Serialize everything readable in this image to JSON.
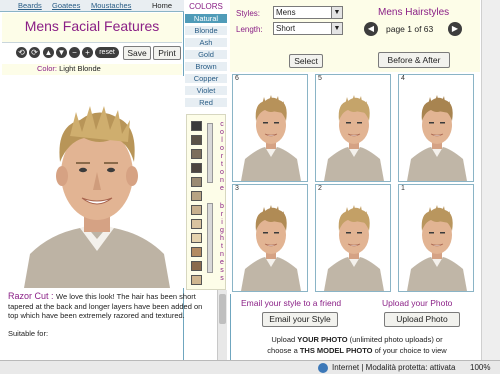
{
  "tabs": [
    "Beards",
    "Goatees",
    "Moustaches",
    "Home"
  ],
  "facial_title": "Mens Facial Features",
  "toolbar": {
    "tool_icons": [
      "rotate-left-icon",
      "rotate-right-icon",
      "arrow-up-icon",
      "arrow-down-icon",
      "minus-icon",
      "plus-icon"
    ],
    "reset_label": "reset",
    "save_label": "Save",
    "print_label": "Print"
  },
  "color_label": {
    "key": "Color:",
    "value": "Light Blonde"
  },
  "colors_heading": "COLORS",
  "colors": [
    "Natural",
    "Blonde",
    "Ash",
    "Gold",
    "Brown",
    "Copper",
    "Violet",
    "Red"
  ],
  "selected_color": "Natural",
  "swatches": [
    "#3a3a3a",
    "#5a5248",
    "#7c6e5c",
    "#4d4540",
    "#9a8a72",
    "#b7a383",
    "#c7b08f",
    "#d9c39f",
    "#e5d3ae",
    "#b38b62",
    "#8a6a4c",
    "#cfb690"
  ],
  "color_tone_label": "color tone",
  "brightness_label": "brightness",
  "description": {
    "heading": "Razor Cut",
    "text": "We love this look! The hair has been short tapered at the back and longer layers have been added on top which have been extremely razored and textured.",
    "suitable": "Suitable for:"
  },
  "styles": {
    "label": "Styles:",
    "value": "Mens"
  },
  "length": {
    "label": "Length:",
    "value": "Short"
  },
  "hairstyles_title": "Mens Hairstyles",
  "page": {
    "text": "page 1 of 63"
  },
  "select_label": "Select",
  "before_after_label": "Before & After",
  "grid_numbers": [
    "6",
    "5",
    "4",
    "3",
    "2",
    "1"
  ],
  "email": {
    "heading": "Email your style to a friend",
    "button": "Email your Style"
  },
  "upload": {
    "heading": "Upload your Photo",
    "button": "Upload Photo",
    "line1_pre": "Upload ",
    "line1_bold": "YOUR PHOTO",
    "line1_post": " (unlimited photo uploads) or",
    "line2_pre": "choose a ",
    "line2_bold": "THS MODEL PHOTO",
    "line2_post": " of your choice to view"
  },
  "statusbar": {
    "zone": "Internet | Modalità protetta: attivata",
    "zoom": "100%"
  }
}
